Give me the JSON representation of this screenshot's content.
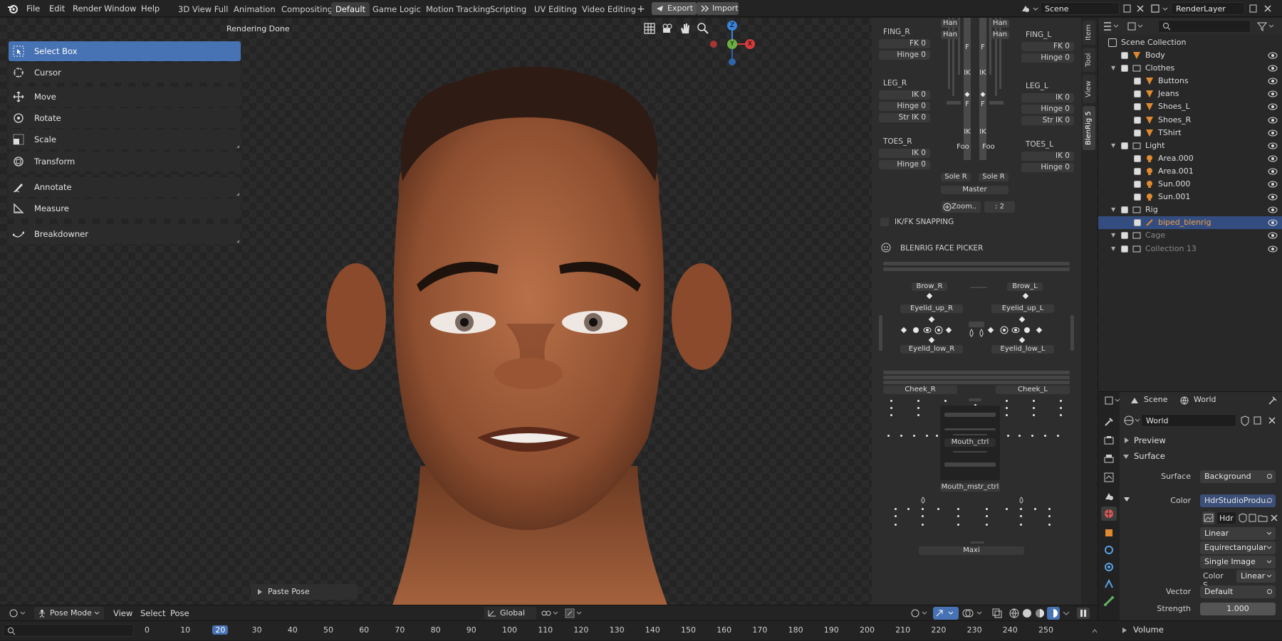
{
  "menu": {
    "file": "File",
    "edit": "Edit",
    "render": "Render",
    "window": "Window",
    "help": "Help"
  },
  "workspaces": [
    "3D View Full",
    "Animation",
    "Compositing",
    "Default",
    "Game Logic",
    "Motion Tracking",
    "Scripting",
    "UV Editing",
    "Video Editing"
  ],
  "active_workspace": "Default",
  "top_actions": {
    "add": "+",
    "export": "Export",
    "import": "Import"
  },
  "scene_field": "Scene",
  "layer_field": "RenderLayer",
  "viewport": {
    "status": "Rendering Done",
    "last_op": "Paste Pose"
  },
  "gizmo": {
    "z": "Z",
    "y": "Y",
    "x": "X"
  },
  "tools": [
    {
      "label": "Select Box",
      "icon": "select-box-icon"
    },
    {
      "label": "Cursor",
      "icon": "cursor-icon"
    },
    {
      "label": "Move",
      "icon": "move-icon"
    },
    {
      "label": "Rotate",
      "icon": "rotate-icon"
    },
    {
      "label": "Scale",
      "icon": "scale-icon"
    },
    {
      "label": "Transform",
      "icon": "transform-icon"
    },
    {
      "label": "Annotate",
      "icon": "annotate-icon"
    },
    {
      "label": "Measure",
      "icon": "measure-icon"
    },
    {
      "label": "Breakdowner",
      "icon": "breakdowner-icon"
    }
  ],
  "picker": {
    "fing_r": {
      "title": "FING_R",
      "fk": "FK 0",
      "hinge": "Hinge 0"
    },
    "fing_l": {
      "title": "FING_L",
      "fk": "FK 0",
      "hinge": "Hinge 0"
    },
    "leg_r": {
      "title": "LEG_R",
      "ik": "IK 0",
      "hinge": "Hinge 0",
      "str": "Str IK 0"
    },
    "leg_l": {
      "title": "LEG_L",
      "ik": "IK 0",
      "hinge": "Hinge 0",
      "str": "Str IK 0"
    },
    "toes_r": {
      "title": "TOES_R",
      "ik": "IK 0",
      "hinge": "Hinge 0"
    },
    "toes_l": {
      "title": "TOES_L",
      "ik": "IK 0",
      "hinge": "Hinge 0"
    },
    "han": "Han",
    "f": "F",
    "ik": "IK",
    "foot": "Foo",
    "sole_r": "Sole R",
    "sole_l": "Sole R",
    "master": "Master",
    "zoom": "Zoom..",
    "zoom_value": ": 2",
    "ikfk": "IK/FK SNAPPING",
    "face_title": "BLENRIG FACE PICKER",
    "brow_r": "Brow_R",
    "brow_l": "Brow_L",
    "eyelid_up_r": "Eyelid_up_R",
    "eyelid_up_l": "Eyelid_up_L",
    "eyelid_low_r": "Eyelid_low_R",
    "eyelid_low_l": "Eyelid_low_L",
    "cheek_r": "Cheek_R",
    "cheek_l": "Cheek_L",
    "mouth_ctrl": "Mouth_ctrl",
    "mouth_mstr": "Mouth_mstr_ctrl",
    "maxi": "Maxi"
  },
  "side_tabs": [
    "Item",
    "Tool",
    "View",
    "BlenRig 5"
  ],
  "outliner": {
    "root": "Scene Collection",
    "rows": [
      {
        "name": "Body",
        "depth": 1,
        "type": "mesh"
      },
      {
        "name": "Clothes",
        "depth": 1,
        "type": "collection"
      },
      {
        "name": "Buttons",
        "depth": 2,
        "type": "mesh"
      },
      {
        "name": "Jeans",
        "depth": 2,
        "type": "mesh"
      },
      {
        "name": "Shoes_L",
        "depth": 2,
        "type": "mesh"
      },
      {
        "name": "Shoes_R",
        "depth": 2,
        "type": "mesh"
      },
      {
        "name": "TShirt",
        "depth": 2,
        "type": "mesh"
      },
      {
        "name": "Light",
        "depth": 1,
        "type": "collection"
      },
      {
        "name": "Area.000",
        "depth": 2,
        "type": "light"
      },
      {
        "name": "Area.001",
        "depth": 2,
        "type": "light"
      },
      {
        "name": "Sun.000",
        "depth": 2,
        "type": "light"
      },
      {
        "name": "Sun.001",
        "depth": 2,
        "type": "light"
      },
      {
        "name": "Rig",
        "depth": 1,
        "type": "collection"
      },
      {
        "name": "biped_blenrig",
        "depth": 2,
        "type": "armature",
        "selected": true
      },
      {
        "name": "Cage",
        "depth": 1,
        "type": "collection",
        "dim": true
      },
      {
        "name": "Collection 13",
        "depth": 1,
        "type": "collection",
        "dim": true
      }
    ]
  },
  "properties": {
    "scene": "Scene",
    "world": "World",
    "world_field": "World",
    "preview": "Preview",
    "surface": "Surface",
    "surface_label": "Surface",
    "surface_value": "Background",
    "color_label": "Color",
    "color_value": "HdrStudioProdu..",
    "image_name": "Hdr",
    "interp": "Linear",
    "projection": "Equirectangular",
    "source": "Single Image",
    "colorspace_label": "Color S..",
    "colorspace_value": "Linear",
    "vector_label": "Vector",
    "vector_value": "Default",
    "strength_label": "Strength",
    "strength_value": "1.000",
    "volume": "Volume"
  },
  "mode_bar": {
    "mode": "Pose Mode",
    "view": "View",
    "select": "Select",
    "pose": "Pose",
    "orientation": "Global"
  },
  "timeline": {
    "current": "20",
    "frames": [
      "0",
      "10",
      "20",
      "30",
      "40",
      "50",
      "60",
      "70",
      "80",
      "90",
      "100",
      "110",
      "120",
      "130",
      "140",
      "150",
      "160",
      "170",
      "180",
      "190",
      "200",
      "210",
      "220",
      "230",
      "240",
      "250"
    ]
  }
}
